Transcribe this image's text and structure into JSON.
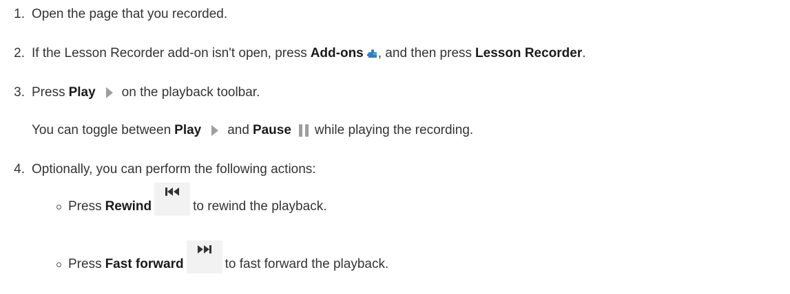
{
  "steps": [
    {
      "number": "1.",
      "text": "Open the page that you recorded."
    },
    {
      "number": "2.",
      "text_before": "If the Lesson Recorder add-on isn't open, press",
      "bold_1": "Add-ons",
      "text_middle": ", and then press",
      "bold_2": "Lesson Recorder",
      "text_after": "."
    },
    {
      "number": "3.",
      "text_before": "Press",
      "bold_1": "Play",
      "text_after": "on the playback toolbar."
    },
    {
      "note_before": "You can toggle between",
      "note_bold_1": "Play",
      "note_middle": "and",
      "note_bold_2": "Pause",
      "note_after": "while playing the recording."
    },
    {
      "number": "4.",
      "text": "Optionally, you can perform the following actions:"
    }
  ],
  "actions": [
    {
      "text_before": "Press",
      "bold": "Rewind",
      "text_after": "to rewind the playback.",
      "icon": "rewind-icon"
    },
    {
      "text_before": "Press",
      "bold": "Fast forward",
      "text_after": "to fast forward the playback.",
      "icon": "fast-forward-icon"
    }
  ],
  "colors": {
    "text": "#333333",
    "addons_icon_blue": "#2f7fc1",
    "icon_gray": "#9e9e9e",
    "button_bg": "#f2f2f2"
  }
}
